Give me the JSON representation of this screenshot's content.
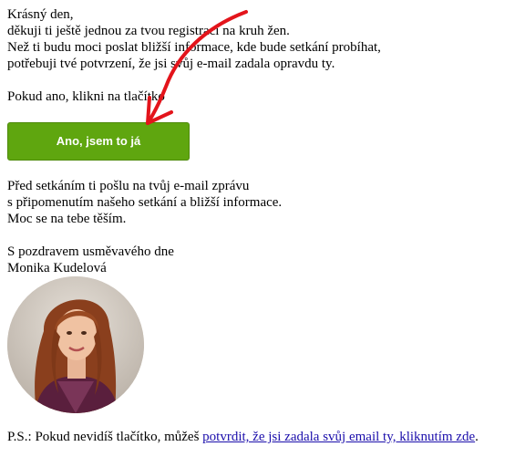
{
  "greeting": {
    "lines": [
      "Krásný den,",
      "děkuji ti ještě jednou za tvou registraci na kruh žen.",
      "Než ti budu moci poslat bližší informace, kde bude setkání probíhat,",
      "potřebuji tvé potvrzení, že jsi svůj e-mail zadala opravdu ty."
    ]
  },
  "prompt": "Pokud ano, klikni na tlačítko",
  "cta": {
    "label": "Ano, jsem to já",
    "color": "#5fa60f"
  },
  "followup": {
    "lines": [
      "Před setkáním ti pošlu na tvůj e-mail zprávu",
      "s připomenutím našeho setkání a bližší informace.",
      "Moc se na tebe těším."
    ]
  },
  "signature": {
    "closing": "S pozdravem usměvavého dne",
    "name": "Monika Kudelová"
  },
  "ps": {
    "prefix": "P.S.: Pokud nevidíš tlačítko, můžeš ",
    "link": "potvrdit, že jsi zadala svůj email ty, kliknutím zde",
    "suffix": "."
  },
  "annotation": {
    "icon": "red-arrow-icon",
    "color": "#e3141b"
  }
}
